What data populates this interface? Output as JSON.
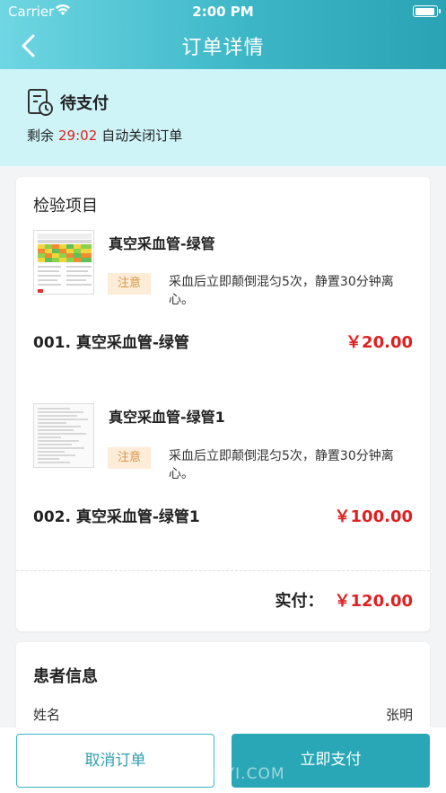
{
  "status_bar": {
    "carrier": "Carrier",
    "time": "2:00 PM"
  },
  "header": {
    "title": "订单详情"
  },
  "order_status": {
    "title": "待支付",
    "countdown_prefix": "剩余",
    "countdown_time": "29:02",
    "countdown_suffix": "自动关闭订单"
  },
  "items_card": {
    "title": "检验项目",
    "items": [
      {
        "name": "真空采血管-绿管",
        "note_tag": "注意",
        "note_text": "采血后立即颠倒混匀5次，静置30分钟离心。",
        "code_name": "001. 真空采血管-绿管",
        "price": "￥20.00"
      },
      {
        "name": "真空采血管-绿管1",
        "note_tag": "注意",
        "note_text": "采血后立即颠倒混匀5次，静置30分钟离心。",
        "code_name": "002. 真空采血管-绿管1",
        "price": "￥100.00"
      }
    ],
    "total_label": "实付：",
    "total_value": "￥120.00"
  },
  "patient_card": {
    "title": "患者信息",
    "name_label": "姓名",
    "name_value": "张明"
  },
  "actions": {
    "cancel_label": "取消订单",
    "pay_label": "立即支付"
  },
  "watermark": "新趣手游 XINYI.COM",
  "colors": {
    "accent": "#2aa7b6",
    "price_red": "#e02020",
    "status_bg": "#cef4f8",
    "note_bg": "#fdecd8"
  }
}
